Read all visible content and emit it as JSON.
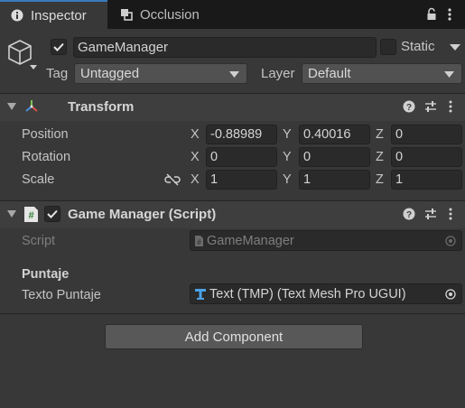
{
  "tabs": [
    {
      "label": "Inspector",
      "icon": "info-icon",
      "active": true
    },
    {
      "label": "Occlusion",
      "icon": "occlusion-icon",
      "active": false
    }
  ],
  "header": {
    "object_name": "GameManager",
    "active": true,
    "static_label": "Static",
    "tag_label": "Tag",
    "tag_value": "Untagged",
    "layer_label": "Layer",
    "layer_value": "Default"
  },
  "transform": {
    "title": "Transform",
    "rows": [
      {
        "label": "Position",
        "x": "-0.88989",
        "y": "0.40016",
        "z": "0"
      },
      {
        "label": "Rotation",
        "x": "0",
        "y": "0",
        "z": "0"
      },
      {
        "label": "Scale",
        "x": "1",
        "y": "1",
        "z": "1"
      }
    ],
    "axes": {
      "x": "X",
      "y": "Y",
      "z": "Z"
    }
  },
  "script_component": {
    "title": "Game Manager (Script)",
    "enabled": true,
    "script_label": "Script",
    "script_value": "GameManager",
    "section_header": "Puntaje",
    "field_label": "Texto Puntaje",
    "field_value": "Text (TMP) (Text Mesh Pro UGUI)"
  },
  "add_component_label": "Add Component",
  "colors": {
    "accent": "#3a79bb",
    "background": "#383838",
    "tabbar": "#191919",
    "field": "#2a2a2a"
  }
}
